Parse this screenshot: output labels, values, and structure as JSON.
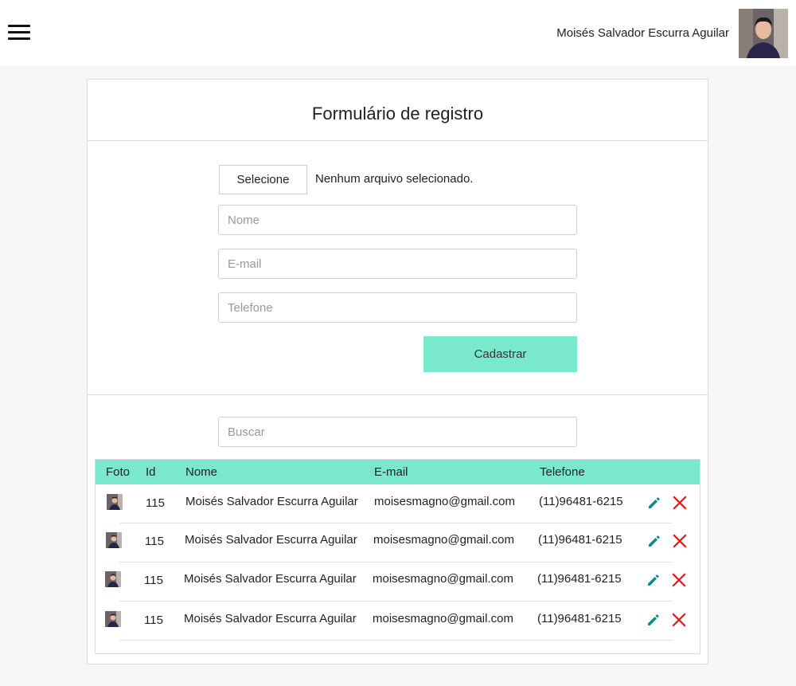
{
  "header": {
    "user_name": "Moisés Salvador Escurra Aguilar"
  },
  "form": {
    "title": "Formulário de registro",
    "file_button": "Selecione",
    "file_status": "Nenhum arquivo selecionado.",
    "name_placeholder": "Nome",
    "email_placeholder": "E-mail",
    "phone_placeholder": "Telefone",
    "submit_label": "Cadastrar"
  },
  "search": {
    "placeholder": "Buscar"
  },
  "table": {
    "headers": [
      "Foto",
      "Id",
      "Nome",
      "E-mail",
      "Telefone"
    ],
    "rows": [
      {
        "id": "115",
        "name": "Moisés Salvador Escurra Aguilar",
        "email": "moisesmagno@gmail.com",
        "phone": "(11)96481-6215"
      },
      {
        "id": "115",
        "name": "Moisés Salvador Escurra Aguilar",
        "email": "moisesmagno@gmail.com",
        "phone": "(11)96481-6215"
      },
      {
        "id": "115",
        "name": "Moisés Salvador Escurra Aguilar",
        "email": "moisesmagno@gmail.com",
        "phone": "(11)96481-6215"
      },
      {
        "id": "115",
        "name": "Moisés Salvador Escurra Aguilar",
        "email": "moisesmagno@gmail.com",
        "phone": "(11)96481-6215"
      }
    ]
  },
  "icons": {
    "menu": "hamburger-menu-icon",
    "edit": "pencil-icon",
    "delete": "close-icon"
  },
  "colors": {
    "accent": "#79e8cc",
    "edit": "#0e8a8a",
    "delete": "#e01818"
  }
}
